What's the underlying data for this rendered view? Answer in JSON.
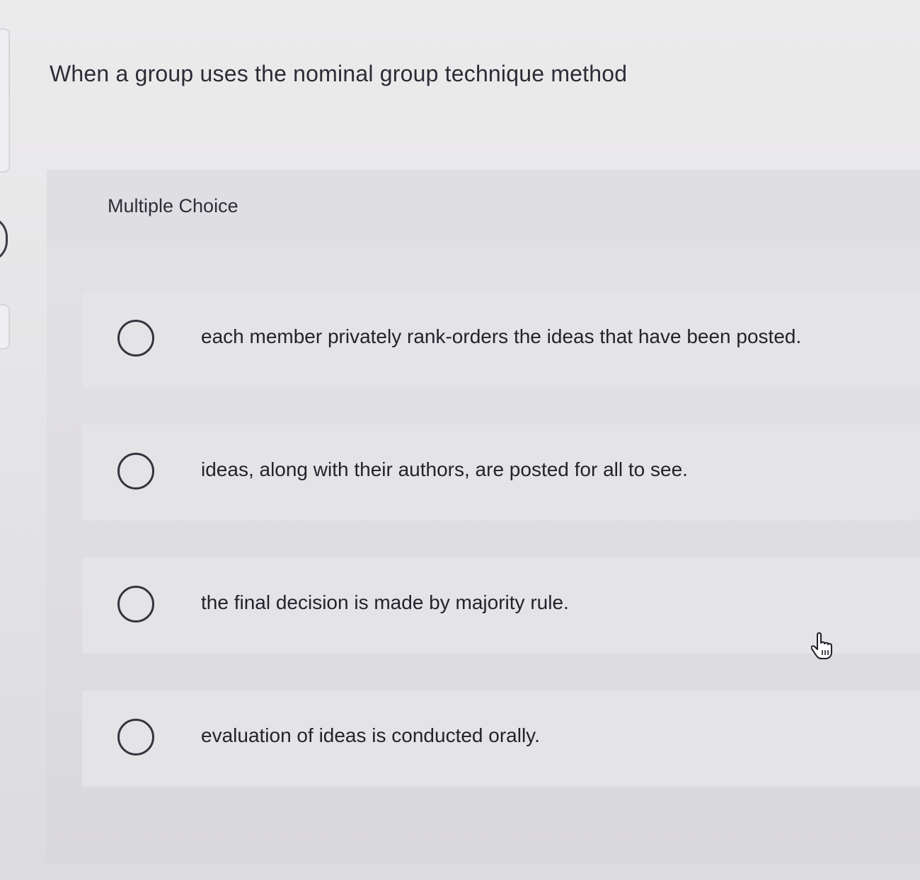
{
  "question": {
    "prompt": "When a group uses the nominal group technique method"
  },
  "multiple_choice": {
    "label": "Multiple Choice",
    "options": [
      {
        "text": "each member privately rank-orders the ideas that have been posted.",
        "selected": false
      },
      {
        "text": "ideas, along with their authors, are posted for all to see.",
        "selected": false
      },
      {
        "text": "the final decision is made by majority rule.",
        "selected": false
      },
      {
        "text": "evaluation of ideas is conducted orally.",
        "selected": false
      }
    ]
  },
  "icons": {
    "radio": "radio-button-icon",
    "cursor": "hand-pointer-icon"
  }
}
